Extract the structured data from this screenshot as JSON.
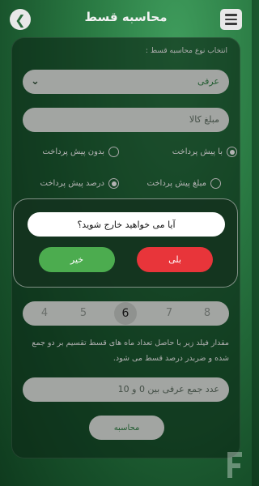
{
  "header": {
    "title": "محاسبه قسط",
    "back_icon": "arrow-left-icon",
    "menu_icon": "hamburger-menu-icon"
  },
  "form": {
    "type_label": "انتخاب نوع محاسبه قسط :",
    "type_value": "عرفی",
    "price_placeholder": "مبلغ کالا",
    "prepay_options": [
      {
        "label": "با پیش پرداخت",
        "selected": true
      },
      {
        "label": "بدون پیش پرداخت",
        "selected": false
      }
    ],
    "prepay_kind_options": [
      {
        "label": "مبلغ پیش پرداخت",
        "selected": false
      },
      {
        "label": "درصد پیش پرداخت",
        "selected": true
      }
    ],
    "month_stepper": {
      "values": [
        "4",
        "5",
        "6",
        "7",
        "8"
      ],
      "selected": "6"
    },
    "description": "مقدار فیلد زیر با حاصل تعداد ماه های قسط تقسیم بر دو جمع شده و ضربدر درصد قسط می شود.",
    "custom_placeholder": "عدد جمع عرفی بین 0 و 10",
    "calculate_label": "محاسبه"
  },
  "dialog": {
    "message": "آیا می خواهید خارج شوید؟",
    "yes_label": "بلی",
    "no_label": "خیر",
    "yes_color": "#e8353a",
    "no_color": "#4cac4f"
  },
  "colors": {
    "background": "#2a7a43",
    "accent": "#2f7d43",
    "field": "#d9dcd9"
  }
}
